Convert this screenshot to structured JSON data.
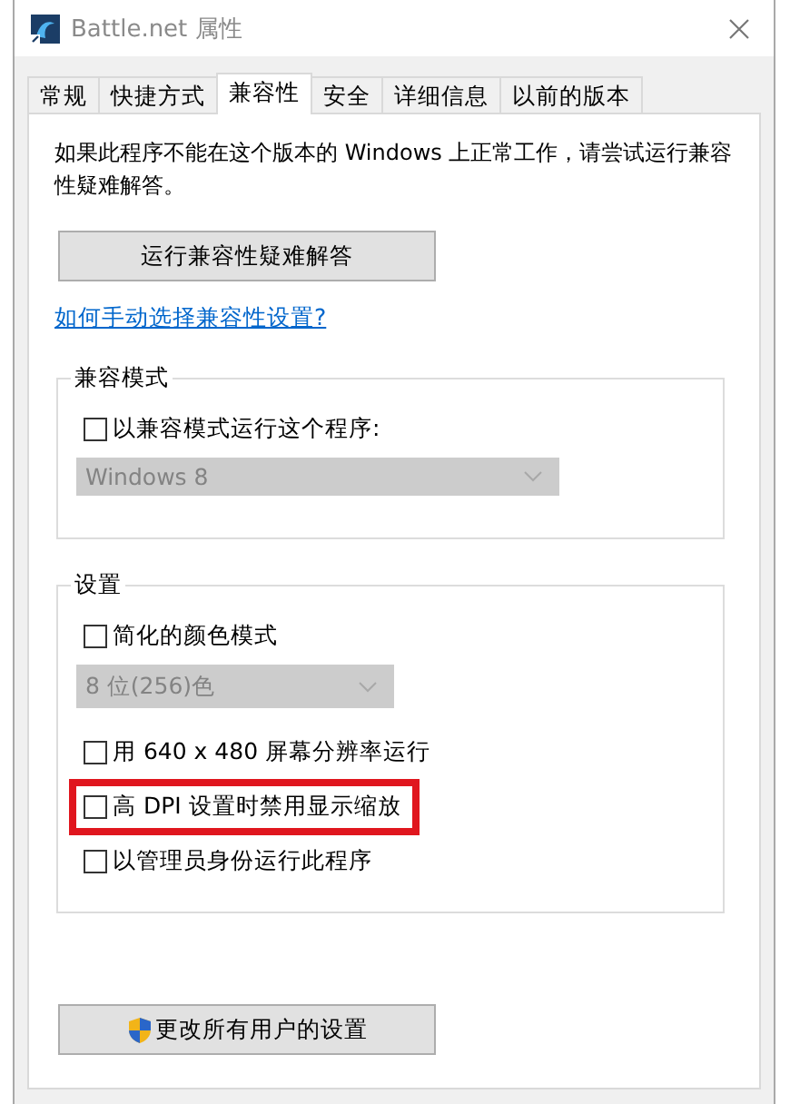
{
  "window": {
    "title": "Battle.net 属性"
  },
  "tabs": [
    {
      "label": "常规",
      "selected": false
    },
    {
      "label": "快捷方式",
      "selected": false
    },
    {
      "label": "兼容性",
      "selected": true
    },
    {
      "label": "安全",
      "selected": false
    },
    {
      "label": "详细信息",
      "selected": false
    },
    {
      "label": "以前的版本",
      "selected": false
    }
  ],
  "description": "如果此程序不能在这个版本的 Windows 上正常工作，请尝试运行兼容性疑难解答。",
  "troubleshoot_button": "运行兼容性疑难解答",
  "help_link": "如何手动选择兼容性设置?",
  "compat_mode": {
    "title": "兼容模式",
    "items": [
      {
        "kind": "checkbox",
        "label": "以兼容模式运行这个程序:",
        "checked": false,
        "highlighted": false
      },
      {
        "kind": "dropdown",
        "value": "Windows 8",
        "disabled": true
      }
    ]
  },
  "settings": {
    "title": "设置",
    "items": [
      {
        "kind": "checkbox",
        "label": "简化的颜色模式",
        "checked": false,
        "highlighted": false
      },
      {
        "kind": "dropdown",
        "value": "8 位(256)色",
        "disabled": true
      },
      {
        "kind": "checkbox",
        "label": "用 640 x 480 屏幕分辨率运行",
        "checked": false,
        "highlighted": false
      },
      {
        "kind": "checkbox",
        "label": "高 DPI 设置时禁用显示缩放",
        "checked": false,
        "highlighted": true
      },
      {
        "kind": "checkbox",
        "label": "以管理员身份运行此程序",
        "checked": false,
        "highlighted": false
      }
    ]
  },
  "change_all_button": "更改所有用户的设置"
}
